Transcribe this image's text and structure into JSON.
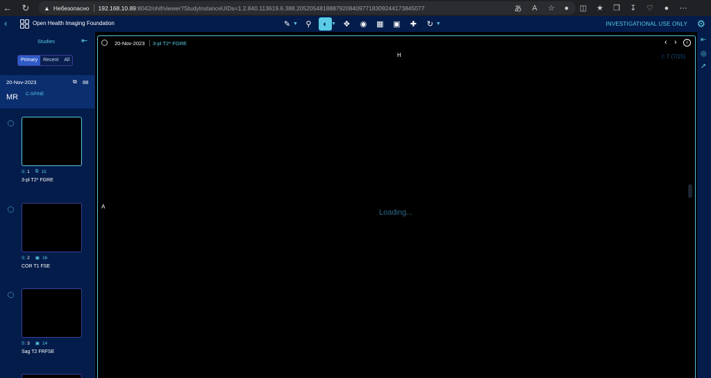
{
  "browser": {
    "insecure_label": "Небезопасно",
    "url_host": "192.168.10.89",
    "url_path": ":8042/ohif/viewer?StudyInstanceUIDs=1.2.840.113619.6.388.205205481888792084097718309244173845077"
  },
  "header": {
    "brand": "Open Health Imaging Foundation",
    "investigational": "INVESTIGATIONAL USE ONLY"
  },
  "left_panel": {
    "title": "Studies",
    "tabs": [
      "Primary",
      "Recent",
      "All"
    ],
    "study": {
      "date": "20-Nov-2023",
      "count": "88",
      "modality": "MR",
      "description": "C-SPINE"
    },
    "series": [
      {
        "s_label": "S:",
        "s_num": "1",
        "instances": "15",
        "name": "3-pl T2* FGRE"
      },
      {
        "s_label": "S:",
        "s_num": "2",
        "instances": "16",
        "name": "COR T1 FSE"
      },
      {
        "s_label": "S:",
        "s_num": "3",
        "instances": "14",
        "name": "Sag T2 FRFSE"
      }
    ]
  },
  "viewport": {
    "date": "20-Nov-2023",
    "description": "3-pl T2* FGRE",
    "orientation_top": "H",
    "orientation_left": "A",
    "image_index": "I: 7 (7/15)",
    "loading": "Loading..."
  },
  "colors": {
    "accent": "#5acce6",
    "header_bg": "#041c4a",
    "study_bg": "#0b2e6f",
    "tab_selected": "#2f5bc8"
  }
}
